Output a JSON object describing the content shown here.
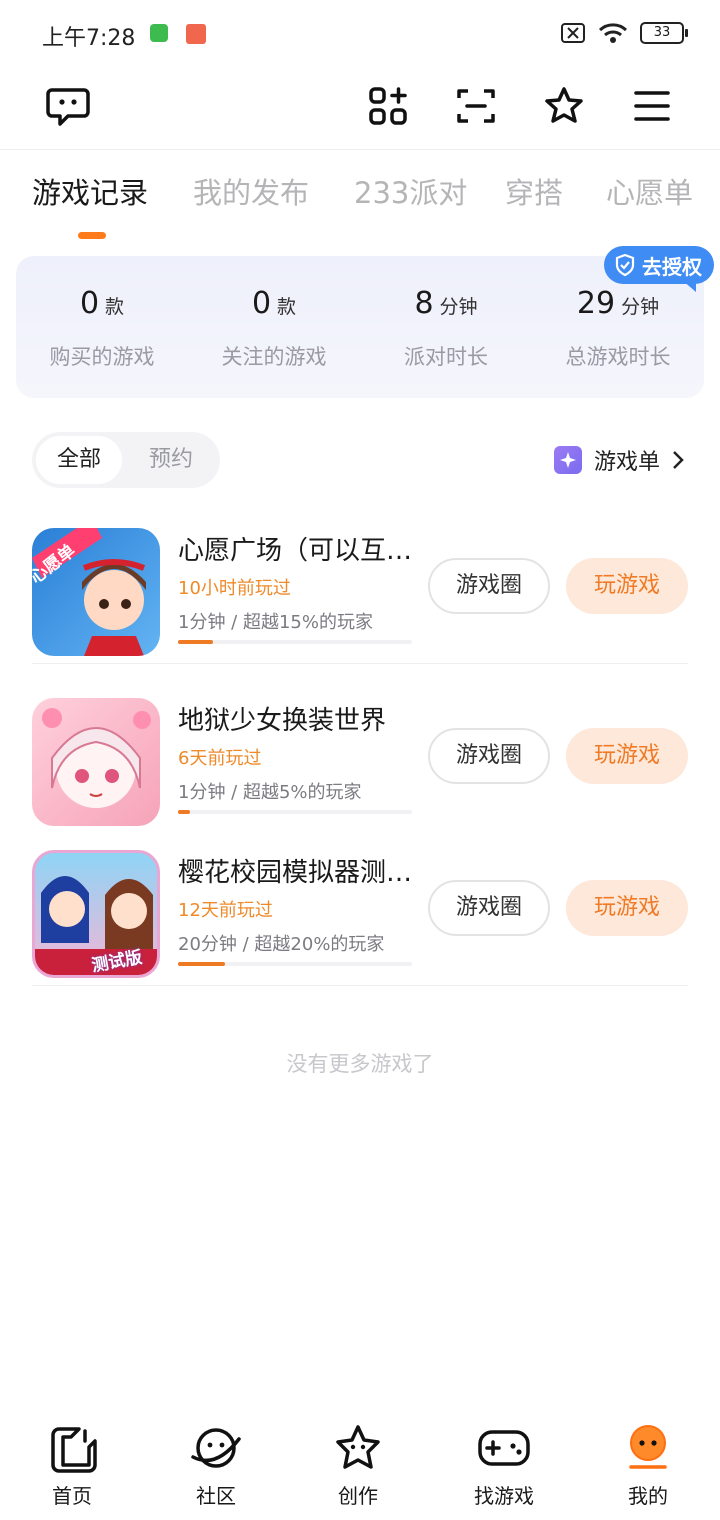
{
  "status_bar": {
    "time": "上午7:28",
    "battery": "33"
  },
  "tabs": [
    {
      "label": "游戏记录"
    },
    {
      "label": "我的发布"
    },
    {
      "label": "233派对"
    },
    {
      "label": "穿搭"
    },
    {
      "label": "心愿单"
    }
  ],
  "auth_badge": "去授权",
  "stats": [
    {
      "value": "0",
      "unit": "款",
      "label": "购买的游戏"
    },
    {
      "value": "0",
      "unit": "款",
      "label": "关注的游戏"
    },
    {
      "value": "8",
      "unit": "分钟",
      "label": "派对时长"
    },
    {
      "value": "29",
      "unit": "分钟",
      "label": "总游戏时长"
    }
  ],
  "filter": {
    "all": "全部",
    "reserve": "预约"
  },
  "game_list_link": "游戏单",
  "games": [
    {
      "title": "心愿广场（可以互…",
      "played": "10小时前玩过",
      "meta": "1分钟 / 超越15%的玩家",
      "progress": 0.15,
      "circle_btn": "游戏圈",
      "play_btn": "玩游戏",
      "icon_text": "心愿单"
    },
    {
      "title": "地狱少女换装世界",
      "played": "6天前玩过",
      "meta": "1分钟 / 超越5%的玩家",
      "progress": 0.05,
      "circle_btn": "游戏圈",
      "play_btn": "玩游戏"
    },
    {
      "title": "樱花校园模拟器测…",
      "played": "12天前玩过",
      "meta": "20分钟 / 超越20%的玩家",
      "progress": 0.2,
      "circle_btn": "游戏圈",
      "play_btn": "玩游戏",
      "icon_text": "测试版"
    }
  ],
  "no_more": "没有更多游戏了",
  "bottom_nav": [
    {
      "label": "首页",
      "icon": "home-icon"
    },
    {
      "label": "社区",
      "icon": "planet-icon"
    },
    {
      "label": "创作",
      "icon": "star-icon"
    },
    {
      "label": "找游戏",
      "icon": "gamepad-icon"
    },
    {
      "label": "我的",
      "icon": "profile-icon"
    }
  ],
  "colors": {
    "accent": "#ef7a24",
    "badge": "#3f8cf5",
    "play_bg": "#fde8d9"
  }
}
